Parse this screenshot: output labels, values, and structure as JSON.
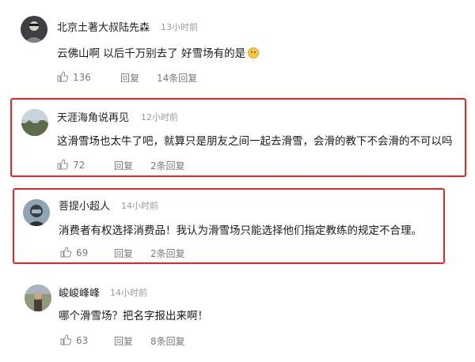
{
  "comments": [
    {
      "username": "北京土著大叔陆先森",
      "time": "13小时前",
      "text": "云佛山啊 以后千万别去了 好雪场有的是",
      "emoji": "smile-emoji",
      "likes": "136",
      "reply_label": "回复",
      "replies_label": "14条回复",
      "highlighted": false
    },
    {
      "username": "天涯海角说再见",
      "time": "12小时前",
      "text": "这滑雪场也太牛了吧，就算只是朋友之间一起去滑雪，会滑的教下不会滑的不可以吗",
      "likes": "72",
      "reply_label": "回复",
      "replies_label": "2条回复",
      "highlighted": true
    },
    {
      "username": "菩提小超人",
      "time": "14小时前",
      "text": "消费者有权选择消费品！我认为滑雪场只能选择他们指定教练的规定不合理。",
      "likes": "69",
      "reply_label": "回复",
      "replies_label": "2条回复",
      "highlighted": true
    },
    {
      "username": "峻峻峰峰",
      "time": "14小时前",
      "text": "哪个滑雪场？把名字报出来啊！",
      "likes": "63",
      "reply_label": "回复",
      "replies_label": "8条回复",
      "highlighted": false
    }
  ],
  "colors": {
    "highlight_border": "#e2262d",
    "username": "#1f1f1f",
    "meta": "#9a9a9a",
    "action": "#7a7a7a"
  },
  "icons": [
    "thumbs-up-icon",
    "avatar"
  ]
}
